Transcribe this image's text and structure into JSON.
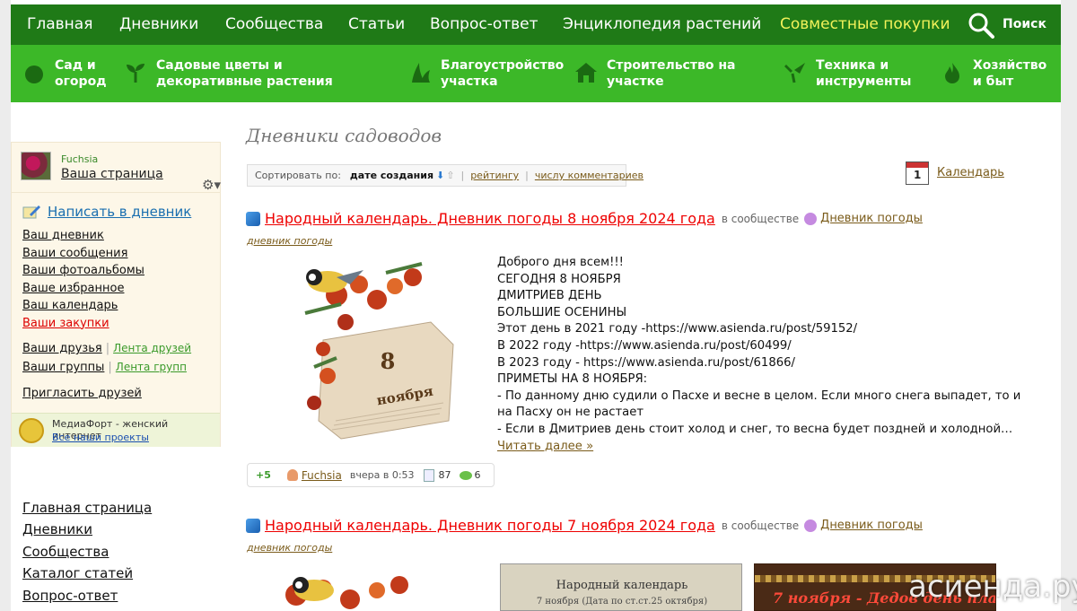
{
  "topnav": {
    "items": [
      "Главная",
      "Дневники",
      "Сообщества",
      "Статьи",
      "Вопрос-ответ",
      "Энциклопедия растений",
      "Совместные покупки"
    ],
    "search_label": "Поиск"
  },
  "categories": [
    {
      "label": "Сад и огород",
      "icon": "tomato-icon"
    },
    {
      "label": "Садовые цветы и декоративные растения",
      "icon": "sprout-icon"
    },
    {
      "label": "Благоустройство участка",
      "icon": "landscape-icon"
    },
    {
      "label": "Строительство на участке",
      "icon": "house-icon"
    },
    {
      "label": "Техника и инструменты",
      "icon": "tools-icon"
    },
    {
      "label": "Хозяйство и быт",
      "icon": "fire-icon"
    }
  ],
  "sidebar": {
    "username": "Fuchsia",
    "my_page": "Ваша страница",
    "write_label": "Написать в дневник",
    "links": [
      "Ваш дневник",
      "Ваши сообщения",
      "Ваши фотоальбомы",
      "Ваше избранное",
      "Ваш календарь",
      "Ваши закупки"
    ],
    "friends": "Ваши друзья",
    "friends_feed": "Лента друзей",
    "groups": "Ваши группы",
    "groups_feed": "Лента групп",
    "invite": "Пригласить друзей",
    "mediafort": "МедиаФорт - женский интернет",
    "all_projects": "Все наши проекты"
  },
  "bottom_links": [
    "Главная страница",
    "Дневники",
    "Сообщества",
    "Каталог статей",
    "Вопрос-ответ"
  ],
  "main": {
    "title": "Дневники садоводов",
    "sort": {
      "label": "Сортировать по:",
      "active": "дате создания",
      "arrows": [
        "⬇",
        "⇧"
      ],
      "rating": "рейтингу",
      "comments": "числу комментариев"
    },
    "calendar_day": "1",
    "calendar_label": "Календарь"
  },
  "posts": [
    {
      "title": "Народный календарь. Дневник погоды 8 ноября 2024 года",
      "in_community": "в сообществе",
      "community": "Дневник погоды",
      "tag": "дневник погоды",
      "image_day": "8",
      "image_month": "ноября",
      "lines": [
        "Доброго дня всем!!!",
        "СЕГОДНЯ 8 НОЯБРЯ",
        "ДМИТРИЕВ ДЕНЬ",
        "БОЛЬШИЕ ОСЕНИНЫ",
        "Этот день в 2021 году -https://www.asienda.ru/post/59152/",
        "В 2022 году -https://www.asienda.ru/post/60499/",
        "В 2023 году - https://www.asienda.ru/post/61866/",
        "ПРИМЕТЫ НА 8 НОЯБРЯ:",
        "- По данному дню судили о Пасхе и весне в целом. Если много снега выпадет, то и на Пасху он не растает",
        "- Если в Дмитриев день стоит холод и снег, то весна будет поздней и холодной…"
      ],
      "read_more": "Читать далее »",
      "rating": "+5",
      "author": "Fuchsia",
      "time": "вчера в 0:53",
      "views": "87",
      "comments": "6"
    },
    {
      "title": "Народный календарь. Дневник погоды 7 ноября 2024 года",
      "in_community": "в сообществе",
      "community": "Дневник погоды",
      "tag": "дневник погоды"
    }
  ],
  "thumbs": {
    "calendar_title": "Народный календарь",
    "calendar_sub": "7 ноября (Дата по ст.ст.25 октября)",
    "dedov_title": "7 ноября - Дедов день плачи"
  },
  "watermark": "асиенда.ру"
}
